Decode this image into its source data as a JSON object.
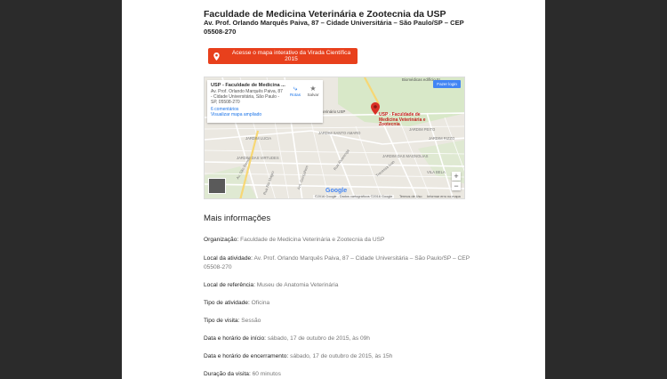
{
  "venue": {
    "title": "Faculdade de Medicina Veterinária e Zootecnia da USP",
    "address": "Av. Prof. Orlando Marquês Paiva, 87 – Cidade Universitária – São Paulo/SP – CEP 05508-270"
  },
  "map_button": {
    "label": "Acesse o mapa interativo da Virada Científica 2015",
    "icon": "map-pin-icon"
  },
  "map": {
    "card_title": "USP - Faculdade de Medicina ...",
    "card_address": "Av. Prof. Orlando Marquês Paiva, 87 - Cidade Universitária, São Paulo - SP, 05508-270",
    "reviews_link": "6 comentários",
    "enlarge_link": "Visualizar mapa ampliado",
    "routes_label": "Rotas",
    "save_label": "Salvar",
    "signin_label": "Fazer login",
    "poi_name": "USP - Faculdade de Medicina Veterinária e Zootecnia",
    "hospital_label": "Hospital Veterinário USP",
    "biomed_label": "Biomédicas edifício III",
    "streets": [
      "JARDIM SANTO AMARO",
      "JARDIM LUCIA",
      "JARDIM DAS VIRTUDES",
      "Av. São Remo",
      "Rua Alvarenga",
      "Travessa Ivan",
      "JARDIM PEITO",
      "JARDIM RIZZO",
      "JARDIM DAS MAGNOLIAS",
      "VILA BELA",
      "Rua Rio Magro",
      "Ant. Gonçalves"
    ],
    "google_label": "Google",
    "attribution": "©2016 Google - Dados cartográficos ©2016 Google",
    "terms_label": "Termos de Uso",
    "report_label": "Informar erro no mapa",
    "zoom_in": "+",
    "zoom_out": "−"
  },
  "more_info": {
    "heading": "Mais informações",
    "fields": [
      {
        "label": "Organização:",
        "value": "Faculdade de Medicina Veterinária e Zootecnia da USP"
      },
      {
        "label": "Local da atividade:",
        "value": "Av. Prof. Orlando Marquês Paiva, 87 – Cidade Universitária – São Paulo/SP – CEP 05508-270"
      },
      {
        "label": "Local de referência:",
        "value": "Museu de Anatomia Veterinária"
      },
      {
        "label": "Tipo de atividade:",
        "value": "Oficina"
      },
      {
        "label": "Tipo de visita:",
        "value": "Sessão"
      },
      {
        "label": "Data e horário de início:",
        "value": "sábado, 17 de outubro de 2015, às 09h"
      },
      {
        "label": "Data e horário de encerramento:",
        "value": "sábado, 17 de outubro de 2015, às 15h"
      },
      {
        "label": "Duração da visita:",
        "value": "60 minutos"
      }
    ]
  }
}
